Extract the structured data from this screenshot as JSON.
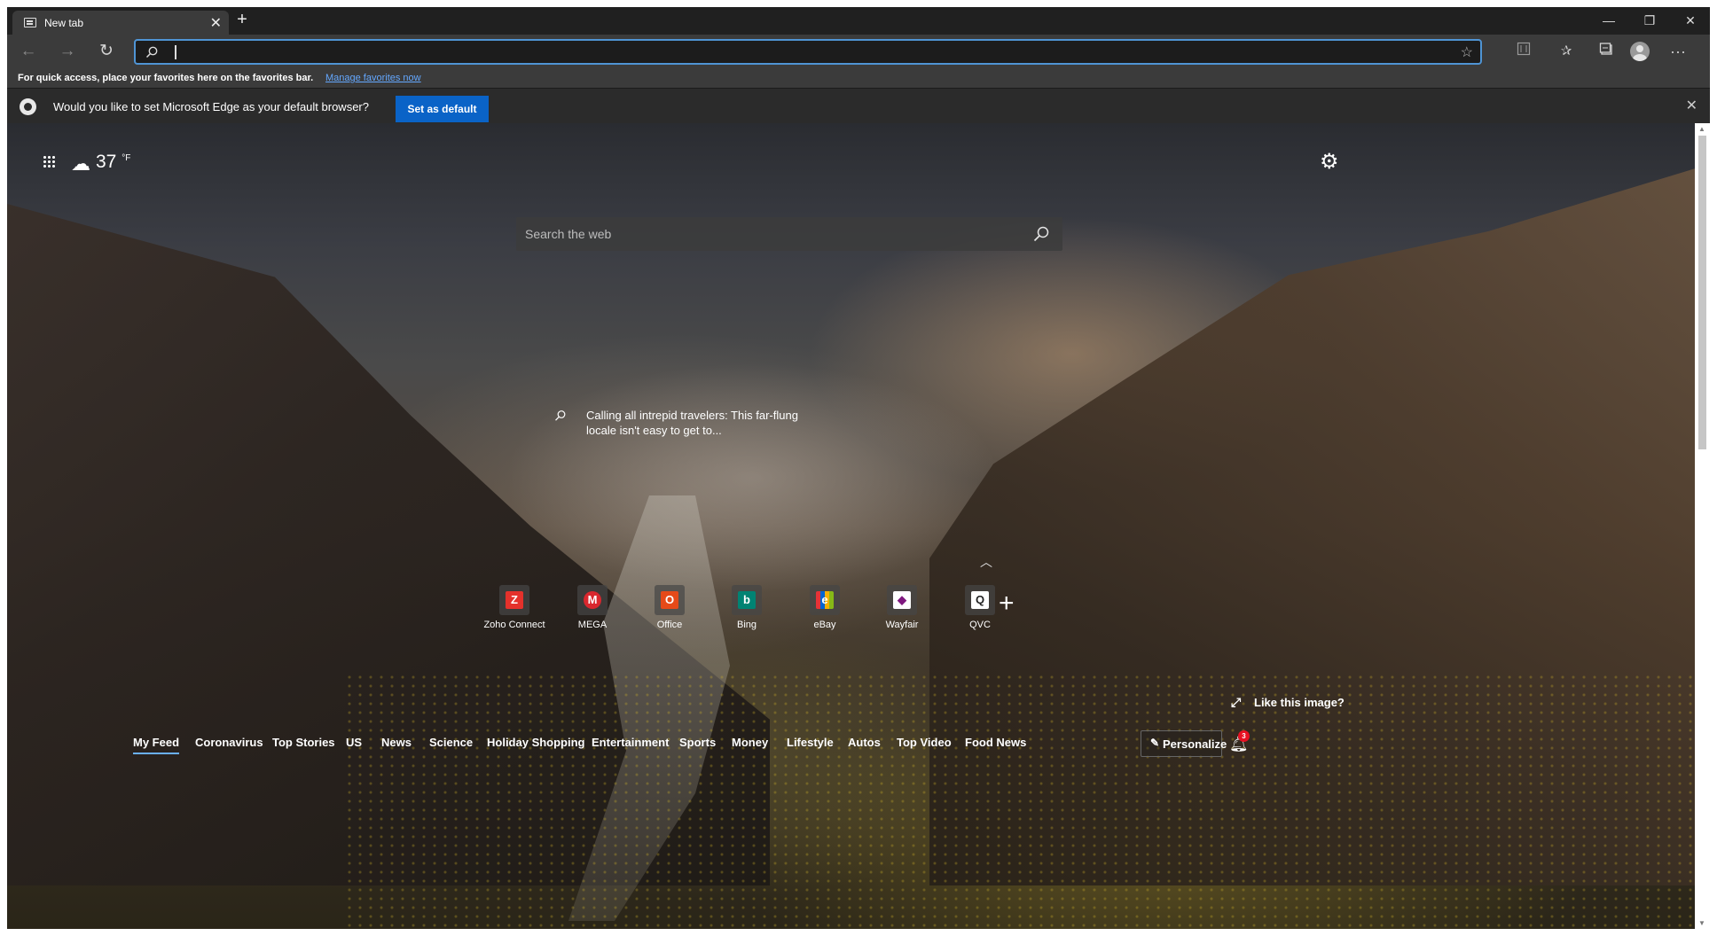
{
  "browser": {
    "tab_title": "New tab",
    "tab_close": "✕",
    "new_tab": "+",
    "window_controls": {
      "minimize": "—",
      "restore": "❐",
      "close": "✕"
    },
    "address": {
      "value": "",
      "placeholder": ""
    },
    "favorites_bar": {
      "message": "For quick access, place your favorites here on the favorites bar.",
      "link": "Manage favorites now"
    },
    "infobar": {
      "message": "Would you like to set Microsoft Edge as your default browser?",
      "button": "Set as default",
      "close": "✕"
    },
    "icons": [
      "back-icon",
      "forward-icon",
      "refresh-icon",
      "search-icon",
      "favorite-star-icon",
      "immersive-reader-icon",
      "favorites-icon",
      "collections-icon",
      "profile-icon",
      "more-icon"
    ],
    "accent": "#4f94d4",
    "button_blue": "#0a63c7"
  },
  "newtab": {
    "weather": {
      "temp": "37",
      "unit": "°F"
    },
    "search": {
      "placeholder": "Search the web"
    },
    "image_caption": "Calling all intrepid travelers: This far-flung locale isn't easy to get to...",
    "top_sites": [
      {
        "label": "Zoho Connect",
        "glyph": "Z",
        "color": "#e4312b"
      },
      {
        "label": "MEGA",
        "glyph": "M",
        "color": "#d9272e"
      },
      {
        "label": "Office",
        "glyph": "O",
        "color": "#e64a19"
      },
      {
        "label": "Bing",
        "glyph": "b",
        "color": "#008373"
      },
      {
        "label": "eBay",
        "glyph": "e",
        "color": "#0064d2"
      },
      {
        "label": "Wayfair",
        "glyph": "◆",
        "color": "#7f187f"
      },
      {
        "label": "QVC",
        "glyph": "Q",
        "color": "#ffffff"
      }
    ],
    "like_image": "Like this image?",
    "feed_tabs": [
      "My Feed",
      "Coronavirus",
      "Top Stories",
      "US",
      "News",
      "Science",
      "Holiday Shopping",
      "Entertainment",
      "Sports",
      "Money",
      "Lifestyle",
      "Autos",
      "Top Video",
      "Food News"
    ],
    "active_feed_tab": "My Feed",
    "personalize": "Personalize",
    "notification_count": "3"
  }
}
